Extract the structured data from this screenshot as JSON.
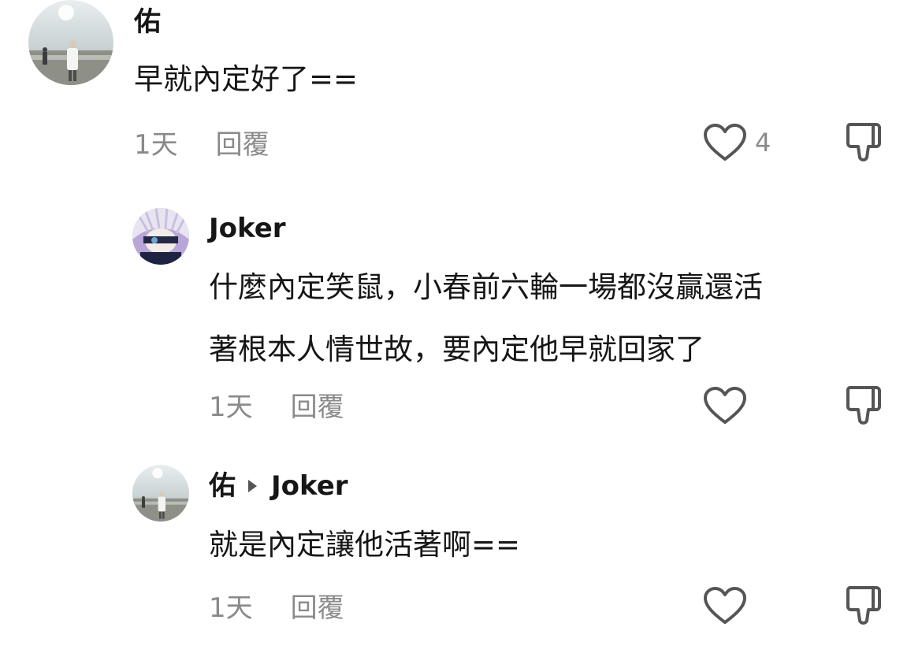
{
  "comments": [
    {
      "author": "佑",
      "text_lines": [
        "早就內定好了=="
      ],
      "time": "1天",
      "reply_label": "回覆",
      "likes": "4"
    },
    {
      "author": "Joker",
      "text_lines": [
        "什麼內定笑鼠，小春前六輪一場都沒贏還活",
        "著根本人情世故，要內定他早就回家了"
      ],
      "time": "1天",
      "reply_label": "回覆",
      "likes": ""
    },
    {
      "author": "佑",
      "reply_to": "Joker",
      "text_lines": [
        "就是內定讓他活著啊=="
      ],
      "time": "1天",
      "reply_label": "回覆",
      "likes": ""
    }
  ],
  "icons": {
    "like": "heart-outline-icon",
    "dislike": "thumbs-down-icon",
    "reply_arrow": "triangle-right-icon"
  },
  "colors": {
    "text": "#161616",
    "meta": "#8a8a8a",
    "icon": "#555555"
  }
}
